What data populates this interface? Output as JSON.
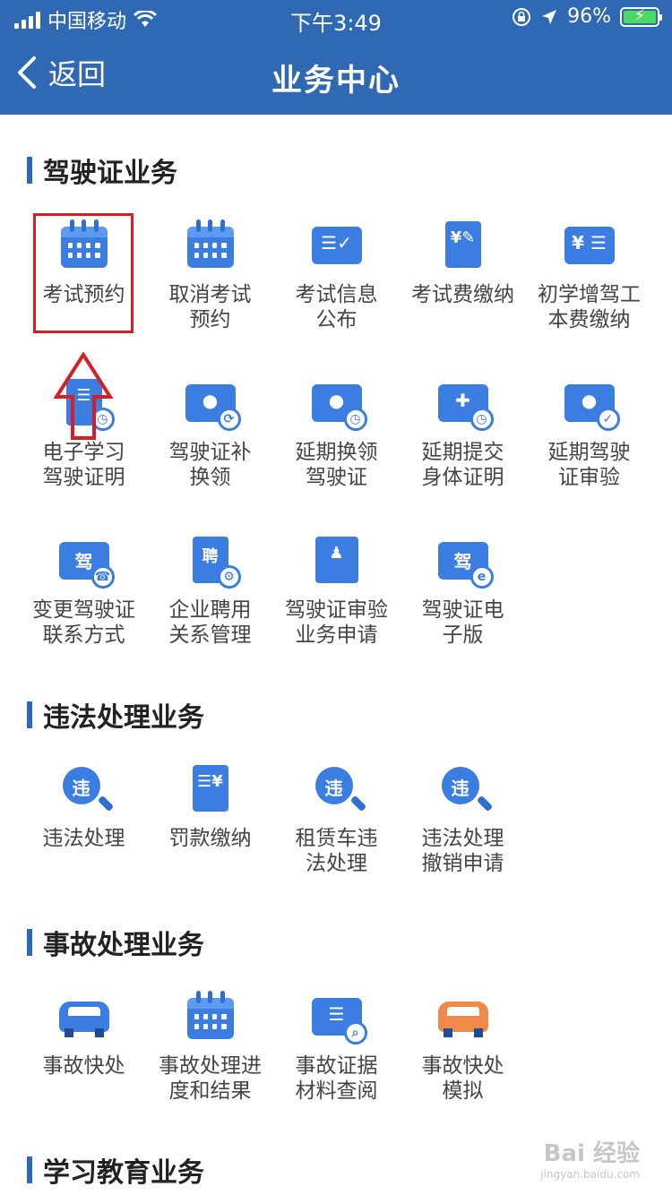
{
  "status_bar": {
    "carrier": "中国移动",
    "time": "下午3:49",
    "battery": "96%"
  },
  "nav": {
    "back_label": "返回",
    "title": "业务中心"
  },
  "sections": [
    {
      "title": "驾驶证业务",
      "items": [
        {
          "label": "考试预约",
          "icon": "calendar-icon"
        },
        {
          "label": "取消考试\n预约",
          "icon": "calendar-icon"
        },
        {
          "label": "考试信息\n公布",
          "icon": "notice-board-icon"
        },
        {
          "label": "考试费缴纳",
          "icon": "fee-receipt-icon"
        },
        {
          "label": "初学增驾工\n本费缴纳",
          "icon": "fee-card-icon"
        },
        {
          "label": "电子学习\n驾驶证明",
          "icon": "learning-cert-icon"
        },
        {
          "label": "驾驶证补\n换领",
          "icon": "license-reissue-icon"
        },
        {
          "label": "延期换领\n驾驶证",
          "icon": "license-delay-icon"
        },
        {
          "label": "延期提交\n身体证明",
          "icon": "health-delay-icon"
        },
        {
          "label": "延期驾驶\n证审验",
          "icon": "license-verify-icon"
        },
        {
          "label": "变更驾驶证\n联系方式",
          "icon": "contact-change-icon"
        },
        {
          "label": "企业聘用\n关系管理",
          "icon": "employment-doc-icon"
        },
        {
          "label": "驾驶证审验\n业务申请",
          "icon": "stamp-icon"
        },
        {
          "label": "驾驶证电\n子版",
          "icon": "e-license-icon"
        }
      ]
    },
    {
      "title": "违法处理业务",
      "items": [
        {
          "label": "违法处理",
          "icon": "violation-search-icon"
        },
        {
          "label": "罚款缴纳",
          "icon": "fine-payment-icon"
        },
        {
          "label": "租赁车违\n法处理",
          "icon": "rental-violation-icon"
        },
        {
          "label": "违法处理\n撤销申请",
          "icon": "violation-cancel-icon"
        }
      ]
    },
    {
      "title": "事故处理业务",
      "items": [
        {
          "label": "事故快处",
          "icon": "car-accident-icon"
        },
        {
          "label": "事故处理进\n度和结果",
          "icon": "progress-calendar-icon"
        },
        {
          "label": "事故证据\n材料查阅",
          "icon": "evidence-search-icon"
        },
        {
          "label": "事故快处\n模拟",
          "icon": "car-accident-orange-icon"
        }
      ]
    },
    {
      "title": "学习教育业务",
      "items": []
    }
  ],
  "watermark": {
    "brand": "Bai 经验",
    "url": "jingyan.baidu.com"
  }
}
